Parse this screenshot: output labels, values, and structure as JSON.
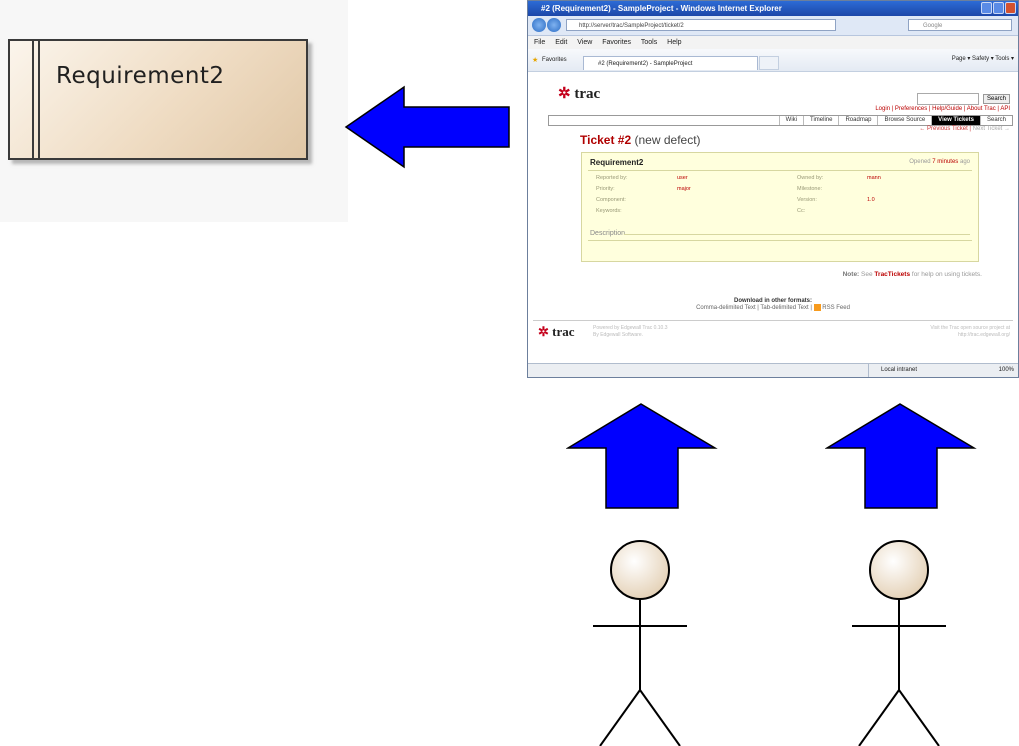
{
  "requirement": {
    "name": "Requirement2"
  },
  "browser": {
    "window_title": "#2 (Requirement2) - SampleProject - Windows Internet Explorer",
    "url": "http://server/trac/SampleProject/ticket/2",
    "search_placeholder": "Google",
    "menu": [
      "File",
      "Edit",
      "View",
      "Favorites",
      "Tools",
      "Help"
    ],
    "favorites_label": "Favorites",
    "tab_title": "#2 (Requirement2) - SampleProject",
    "command_bar": "Page ▾  Safety ▾  Tools ▾",
    "status_zone": "Local intranet",
    "zoom": "100%"
  },
  "trac": {
    "logo": "trac",
    "search_button": "Search",
    "metanav": "Login | Preferences | Help/Guide | About Trac | API",
    "mainnav": [
      "Wiki",
      "Timeline",
      "Roadmap",
      "Browse Source",
      "View Tickets",
      "Search"
    ],
    "ctxnav_prev": "← Previous Ticket",
    "ctxnav_next": "Next Ticket →",
    "ticket_id": "Ticket #2",
    "ticket_status": "(new defect)",
    "summary": "Requirement2",
    "opened_prefix": "Opened",
    "opened_ago": "7 minutes",
    "opened_suffix": "ago",
    "fields": {
      "reported_by_label": "Reported by:",
      "reported_by": "user",
      "owned_by_label": "Owned by:",
      "owned_by": "mann",
      "priority_label": "Priority:",
      "priority": "major",
      "milestone_label": "Milestone:",
      "milestone": "",
      "component_label": "Component:",
      "component": "",
      "version_label": "Version:",
      "version": "1.0",
      "keywords_label": "Keywords:",
      "keywords": "",
      "cc_label": "Cc:",
      "cc": ""
    },
    "description_label": "Description",
    "note_prefix": "Note:",
    "note_see": "See",
    "note_link": "TracTickets",
    "note_suffix": "for help on using tickets.",
    "download_header": "Download in other formats:",
    "download_links": "Comma-delimited Text | Tab-delimited Text",
    "rss": "RSS Feed",
    "powered_by": "Powered by Edgewall Trac 0.10.3",
    "powered_by2": "By Edgewall Software.",
    "visit": "Visit the Trac open source project at",
    "visit2": "http://trac.edgewall.org/"
  },
  "colors": {
    "arrow": "#0000ff",
    "arrow_outline": "#000000",
    "requirement_fill": "#efdcc3",
    "actor_head": "#efe0c8"
  }
}
